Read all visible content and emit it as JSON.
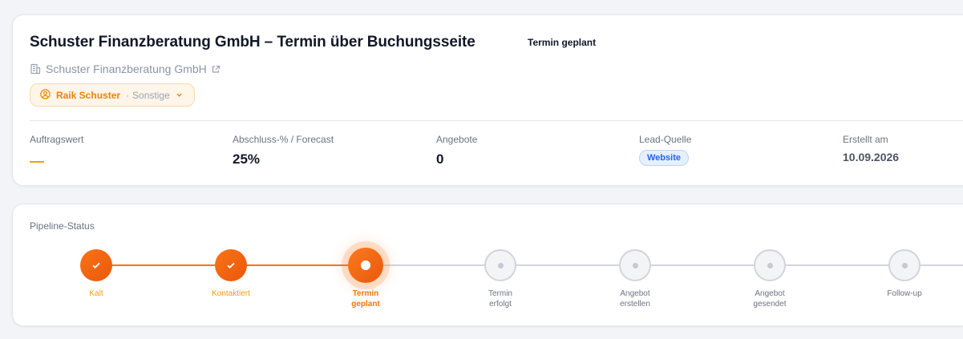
{
  "header": {
    "title": "Schuster Finanzberatung GmbH – Termin über Buchungsseite",
    "status": "Termin geplant",
    "company": "Schuster Finanzberatung GmbH",
    "company_icon": "building-icon",
    "company_link_icon": "external-link-icon"
  },
  "contact": {
    "name": "Raik Schuster",
    "separator": "·",
    "role": "Sonstige",
    "icon": "user-circle-icon"
  },
  "metrics": {
    "order_value": {
      "label": "Auftragswert",
      "value": "—"
    },
    "forecast": {
      "label": "Abschluss-% / Forecast",
      "value": "25%"
    },
    "offers": {
      "label": "Angebote",
      "value": "0"
    },
    "lead_source": {
      "label": "Lead-Quelle",
      "value": "Website"
    },
    "created": {
      "label": "Erstellt am",
      "value": "10.09.2026"
    }
  },
  "pipeline": {
    "label": "Pipeline-Status",
    "steps": [
      {
        "label": "Kalt",
        "state": "done"
      },
      {
        "label": "Kontaktiert",
        "state": "done"
      },
      {
        "label": "Termin\ngeplant",
        "state": "current"
      },
      {
        "label": "Termin\nerfolgt",
        "state": "todo"
      },
      {
        "label": "Angebot\nerstellen",
        "state": "todo"
      },
      {
        "label": "Angebot\ngesendet",
        "state": "todo"
      },
      {
        "label": "Follow-up",
        "state": "todo"
      }
    ]
  },
  "colors": {
    "accent": "#f97316",
    "done_label": "#f59e0b",
    "badge_blue": "#2563eb",
    "track_done": "#f97316",
    "track_todo": "#d1d5db"
  }
}
